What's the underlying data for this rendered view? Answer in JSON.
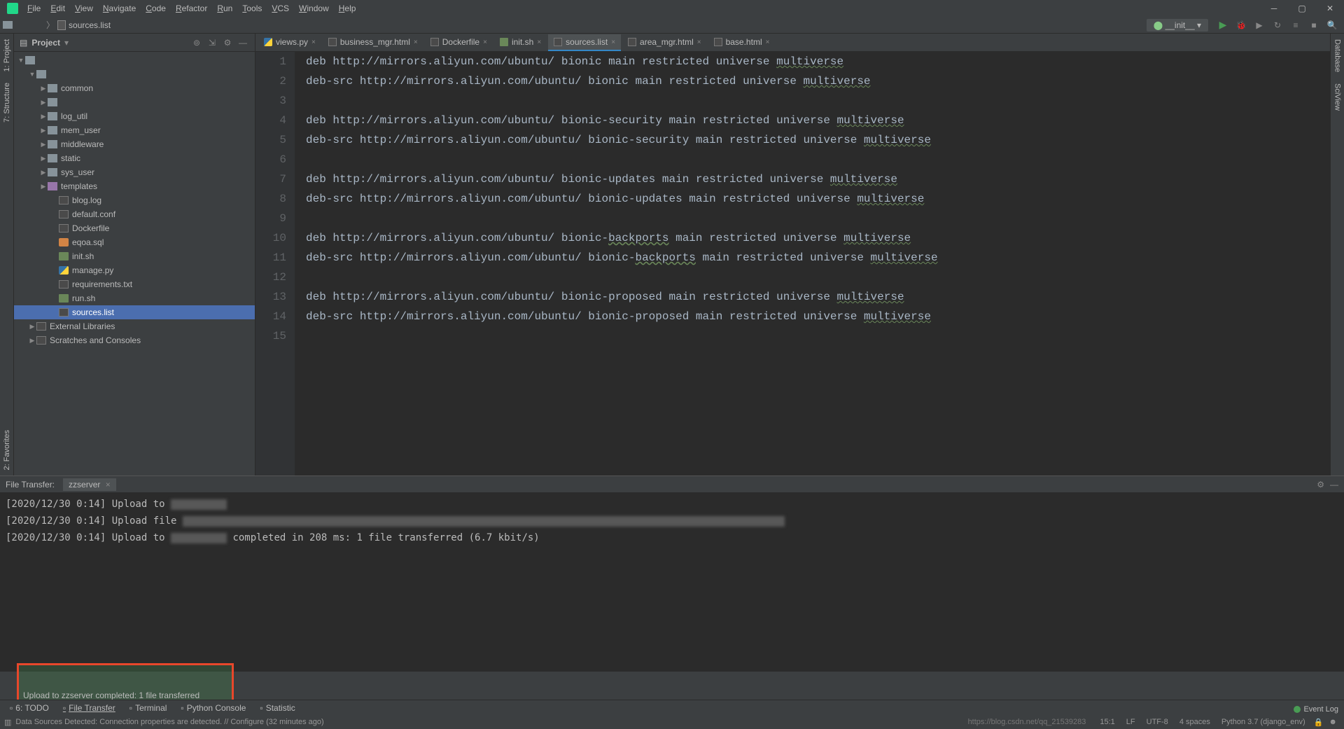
{
  "menu": [
    "File",
    "Edit",
    "View",
    "Navigate",
    "Code",
    "Refactor",
    "Run",
    "Tools",
    "VCS",
    "Window",
    "Help"
  ],
  "breadcrumb": {
    "file": "sources.list"
  },
  "run_config": "__init__",
  "project_panel": {
    "title": "Project"
  },
  "tree": [
    {
      "d": 0,
      "exp": "▼",
      "icon": "fold",
      "name": ""
    },
    {
      "d": 1,
      "exp": "▼",
      "icon": "fold",
      "name": ""
    },
    {
      "d": 2,
      "exp": "▶",
      "icon": "fold",
      "name": "common"
    },
    {
      "d": 2,
      "exp": "▶",
      "icon": "fold",
      "name": ""
    },
    {
      "d": 2,
      "exp": "▶",
      "icon": "fold",
      "name": "log_util"
    },
    {
      "d": 2,
      "exp": "▶",
      "icon": "fold",
      "name": "mem_user"
    },
    {
      "d": 2,
      "exp": "▶",
      "icon": "fold",
      "name": "middleware"
    },
    {
      "d": 2,
      "exp": "▶",
      "icon": "fold",
      "name": "static"
    },
    {
      "d": 2,
      "exp": "▶",
      "icon": "fold",
      "name": "sys_user"
    },
    {
      "d": 2,
      "exp": "▶",
      "icon": "tmpl",
      "name": "templates"
    },
    {
      "d": 3,
      "exp": "",
      "icon": "gry",
      "name": "blog.log"
    },
    {
      "d": 3,
      "exp": "",
      "icon": "gry",
      "name": "default.conf"
    },
    {
      "d": 3,
      "exp": "",
      "icon": "gry",
      "name": "Dockerfile"
    },
    {
      "d": 3,
      "exp": "",
      "icon": "db",
      "name": "eqoa.sql"
    },
    {
      "d": 3,
      "exp": "",
      "icon": "sh",
      "name": "init.sh"
    },
    {
      "d": 3,
      "exp": "",
      "icon": "py",
      "name": "manage.py"
    },
    {
      "d": 3,
      "exp": "",
      "icon": "gry",
      "name": "requirements.txt"
    },
    {
      "d": 3,
      "exp": "",
      "icon": "sh",
      "name": "run.sh"
    },
    {
      "d": 3,
      "exp": "",
      "icon": "gry",
      "name": "sources.list",
      "sel": true
    },
    {
      "d": 1,
      "exp": "▶",
      "icon": "lib",
      "name": "External Libraries"
    },
    {
      "d": 1,
      "exp": "▶",
      "icon": "scr",
      "name": "Scratches and Consoles"
    }
  ],
  "tabs": [
    {
      "name": "views.py",
      "icon": "py"
    },
    {
      "name": "business_mgr.html",
      "icon": "html"
    },
    {
      "name": "Dockerfile",
      "icon": "gry"
    },
    {
      "name": "init.sh",
      "icon": "sh"
    },
    {
      "name": "sources.list",
      "icon": "gry",
      "active": true
    },
    {
      "name": "area_mgr.html",
      "icon": "html"
    },
    {
      "name": "base.html",
      "icon": "html"
    }
  ],
  "code_lines": [
    "deb http://mirrors.aliyun.com/ubuntu/ bionic main restricted universe multiverse",
    "deb-src http://mirrors.aliyun.com/ubuntu/ bionic main restricted universe multiverse",
    "",
    "deb http://mirrors.aliyun.com/ubuntu/ bionic-security main restricted universe multiverse",
    "deb-src http://mirrors.aliyun.com/ubuntu/ bionic-security main restricted universe multiverse",
    "",
    "deb http://mirrors.aliyun.com/ubuntu/ bionic-updates main restricted universe multiverse",
    "deb-src http://mirrors.aliyun.com/ubuntu/ bionic-updates main restricted universe multiverse",
    "",
    "deb http://mirrors.aliyun.com/ubuntu/ bionic-backports main restricted universe multiverse",
    "deb-src http://mirrors.aliyun.com/ubuntu/ bionic-backports main restricted universe multiverse",
    "",
    "deb http://mirrors.aliyun.com/ubuntu/ bionic-proposed main restricted universe multiverse",
    "deb-src http://mirrors.aliyun.com/ubuntu/ bionic-proposed main restricted universe multiverse",
    ""
  ],
  "panel": {
    "title": "File Transfer:",
    "tab": "zzserver",
    "lines": [
      {
        "ts": "[2020/12/30 0:14]",
        "msg": "Upload to ",
        "redact": 80
      },
      {
        "ts": "[2020/12/30 0:14]",
        "msg": "Upload file ",
        "redact": 860
      },
      {
        "ts": "[2020/12/30 0:14]",
        "msg": "Upload to ",
        "redact": 80,
        "suffix": " completed in 208 ms: 1 file transferred (6.7 kbit/s)"
      }
    ]
  },
  "notification": "Upload to zzserver completed: 1 file transferred",
  "bottom_tabs": [
    {
      "label": "6: TODO"
    },
    {
      "label": "File Transfer",
      "sel": true
    },
    {
      "label": "Terminal"
    },
    {
      "label": "Python Console"
    },
    {
      "label": "Statistic"
    }
  ],
  "event_log": "Event Log",
  "status": {
    "msg": "Data Sources Detected: Connection properties are detected. // Configure (32 minutes ago)",
    "caret": "15:1",
    "le": "LF",
    "enc": "UTF-8",
    "indent": "4 spaces",
    "interp": "Python 3.7 (django_env)",
    "watermark": "https://blog.csdn.net/qq_21539283"
  },
  "left_tools": [
    "1: Project",
    "7: Structure"
  ],
  "right_tools": [
    "Database",
    "SciView"
  ],
  "left_lower": [
    "2: Favorites"
  ]
}
